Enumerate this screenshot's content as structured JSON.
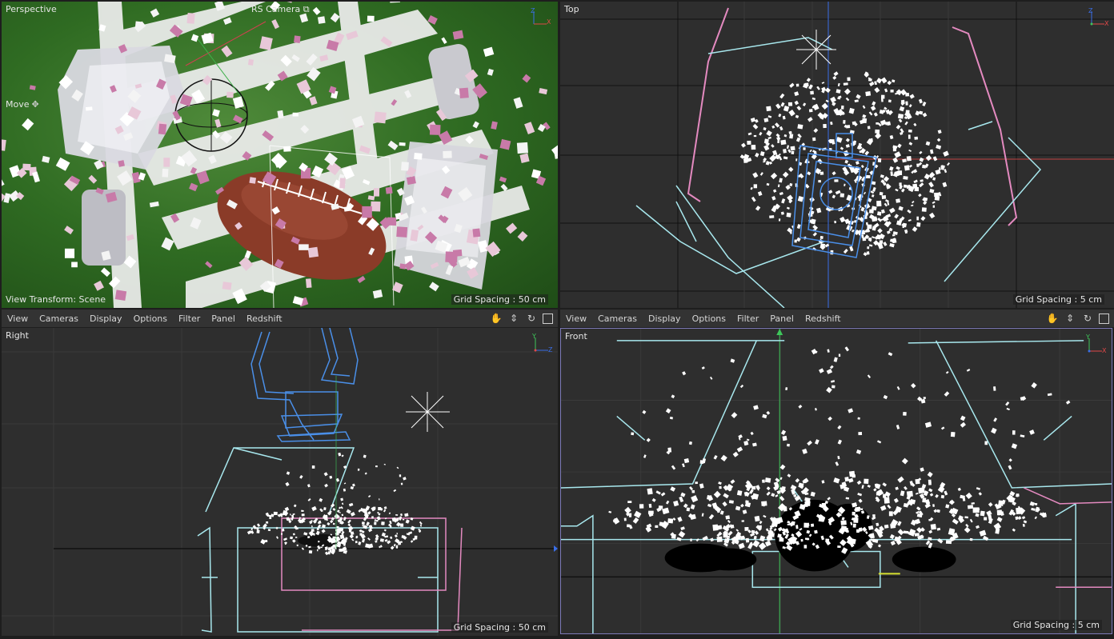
{
  "viewports": {
    "perspective": {
      "label": "Perspective",
      "camera": "RS Camera",
      "tool": "Move",
      "view_transform": "View Transform: Scene",
      "grid_spacing": "Grid Spacing : 50 cm"
    },
    "top": {
      "label": "Top",
      "grid_spacing": "Grid Spacing : 5 cm"
    },
    "right": {
      "label": "Right",
      "grid_spacing": "Grid Spacing : 50 cm"
    },
    "front": {
      "label": "Front",
      "grid_spacing": "Grid Spacing : 5 cm"
    }
  },
  "menus": {
    "left": [
      "View",
      "Cameras",
      "Display",
      "Options",
      "Filter",
      "Panel",
      "Redshift"
    ],
    "right": [
      "View",
      "Cameras",
      "Display",
      "Options",
      "Filter",
      "Panel",
      "Redshift"
    ]
  },
  "toolbar_icons": [
    "pan-icon",
    "dolly-icon",
    "rotate-icon",
    "maximize-icon"
  ],
  "colors": {
    "wire_cyan": "#a8e8ee",
    "wire_pink": "#e48ac0",
    "wire_blue": "#4a8fe8",
    "axis_green": "#3ec65a",
    "axis_red": "#e04848",
    "axis_blue": "#3a6ee8"
  }
}
